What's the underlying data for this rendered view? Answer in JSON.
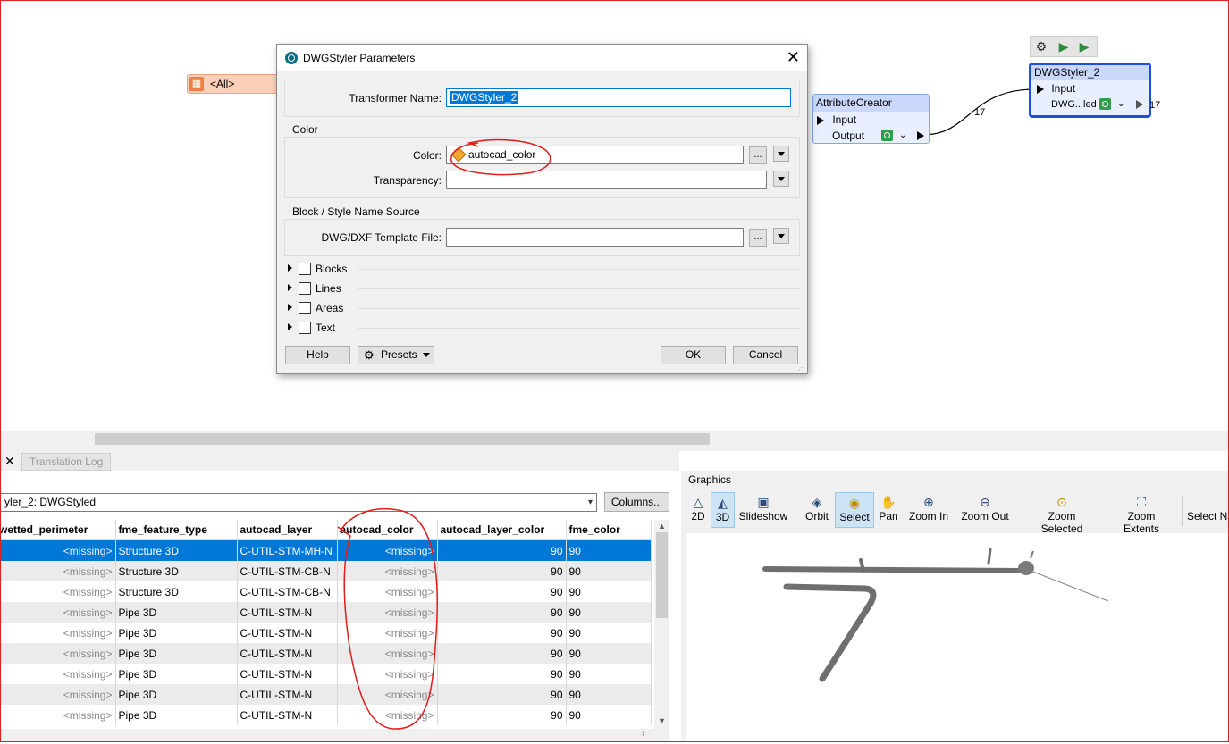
{
  "canvas": {
    "reader_label": "<All>",
    "attribute_creator": {
      "title": "AttributeCreator",
      "input": "Input",
      "output": "Output",
      "count_out": "17"
    },
    "dwgstyler": {
      "title": "DWGStyler_2",
      "input": "Input",
      "output": "DWG...led",
      "count_out": "17"
    }
  },
  "dialog": {
    "title": "DWGStyler Parameters",
    "transformer_name_label": "Transformer Name:",
    "transformer_name_value": "DWGStyler_2",
    "color_group": "Color",
    "color_label": "Color:",
    "color_value": "autocad_color",
    "transparency_label": "Transparency:",
    "transparency_value": "",
    "block_group": "Block / Style Name Source",
    "template_label": "DWG/DXF Template File:",
    "template_value": "",
    "ellipsis": "...",
    "sections": [
      "Blocks",
      "Lines",
      "Areas",
      "Text"
    ],
    "help": "Help",
    "presets": "Presets",
    "ok": "OK",
    "cancel": "Cancel"
  },
  "inspector": {
    "tab_close": "✕",
    "tab_translation_log": "Translation Log",
    "feature_type_selected": "yler_2: DWGStyled",
    "columns_button": "Columns...",
    "columns": [
      "wetted_perimeter",
      "fme_feature_type",
      "autocad_layer",
      "autocad_color",
      "autocad_layer_color",
      "fme_color"
    ],
    "rows": [
      [
        "<missing>",
        "Structure 3D",
        "C-UTIL-STM-MH-N",
        "<missing>",
        "90",
        "90"
      ],
      [
        "<missing>",
        "Structure 3D",
        "C-UTIL-STM-CB-N",
        "<missing>",
        "90",
        "90"
      ],
      [
        "<missing>",
        "Structure 3D",
        "C-UTIL-STM-CB-N",
        "<missing>",
        "90",
        "90"
      ],
      [
        "<missing>",
        "Pipe 3D",
        "C-UTIL-STM-N",
        "<missing>",
        "90",
        "90"
      ],
      [
        "<missing>",
        "Pipe 3D",
        "C-UTIL-STM-N",
        "<missing>",
        "90",
        "90"
      ],
      [
        "<missing>",
        "Pipe 3D",
        "C-UTIL-STM-N",
        "<missing>",
        "90",
        "90"
      ],
      [
        "<missing>",
        "Pipe 3D",
        "C-UTIL-STM-N",
        "<missing>",
        "90",
        "90"
      ],
      [
        "<missing>",
        "Pipe 3D",
        "C-UTIL-STM-N",
        "<missing>",
        "90",
        "90"
      ],
      [
        "<missing>",
        "Pipe 3D",
        "C-UTIL-STM-N",
        "<missing>",
        "90",
        "90"
      ]
    ]
  },
  "graphics": {
    "title": "Graphics",
    "tools": {
      "t2d": "2D",
      "t3d": "3D",
      "slideshow": "Slideshow",
      "orbit": "Orbit",
      "select": "Select",
      "pan": "Pan",
      "zoom_in": "Zoom In",
      "zoom_out": "Zoom Out",
      "zoom_selected": "Zoom Selected",
      "zoom_extents": "Zoom Extents",
      "select_n": "Select N"
    }
  },
  "colors": {
    "selection": "#0078d7",
    "node_title": "#c9d7fb",
    "node_selected_border": "#1a4fe0",
    "annotation": "#e21b1b",
    "reader": "#fbd0b8"
  }
}
